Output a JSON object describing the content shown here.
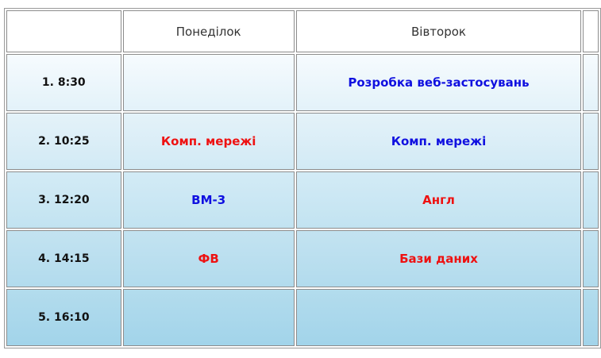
{
  "header": {
    "corner": "",
    "days": [
      "Понеділок",
      "Вівторок",
      ""
    ]
  },
  "rows": [
    {
      "time": "1. 8:30",
      "cells": [
        {
          "text": "",
          "color": ""
        },
        {
          "text": "Розробка веб-застосувань",
          "color": "#1010e0"
        },
        {
          "text": "",
          "color": ""
        }
      ]
    },
    {
      "time": "2. 10:25",
      "cells": [
        {
          "text": "Комп. мережі",
          "color": "#ee1111"
        },
        {
          "text": "Комп. мережі",
          "color": "#1010e0"
        },
        {
          "text": "",
          "color": ""
        }
      ]
    },
    {
      "time": "3. 12:20",
      "cells": [
        {
          "text": "ВМ-3",
          "color": "#1010e0"
        },
        {
          "text": "Англ",
          "color": "#ee1111"
        },
        {
          "text": "",
          "color": ""
        }
      ]
    },
    {
      "time": "4. 14:15",
      "cells": [
        {
          "text": "ФВ",
          "color": "#ee1111"
        },
        {
          "text": "Бази даних",
          "color": "#ee1111"
        },
        {
          "text": "",
          "color": ""
        }
      ]
    },
    {
      "time": "5. 16:10",
      "cells": [
        {
          "text": "",
          "color": ""
        },
        {
          "text": "",
          "color": ""
        },
        {
          "text": "",
          "color": ""
        }
      ]
    }
  ],
  "colors": {
    "blue_subject": "#1010e0",
    "red_subject": "#ee1111",
    "border": "#8c8c8c"
  }
}
